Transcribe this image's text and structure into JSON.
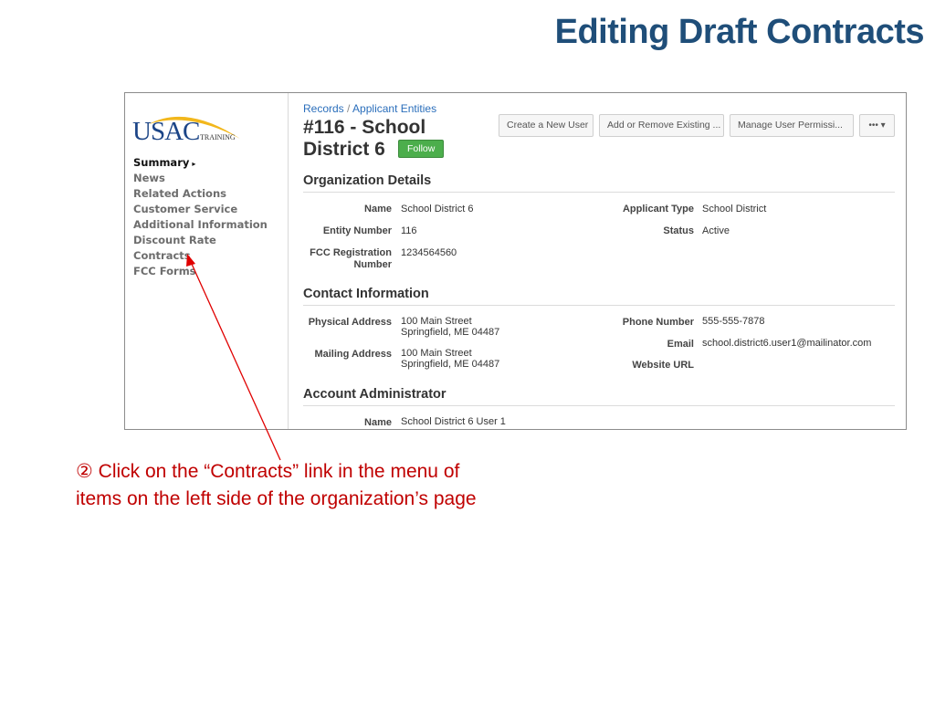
{
  "slide": {
    "title": "Editing Draft Contracts",
    "caption_line1": "② Click on the “Contracts” link in the menu of",
    "caption_line2": "items on the left side of the organization’s page",
    "annotation_color": "#c00000"
  },
  "logo": {
    "name": "USAC",
    "sub": "TRAINING"
  },
  "sidebar": {
    "items": [
      {
        "label": "Summary",
        "active": true
      },
      {
        "label": "News"
      },
      {
        "label": "Related Actions"
      },
      {
        "label": "Customer Service"
      },
      {
        "label": "Additional Information"
      },
      {
        "label": "Discount Rate"
      },
      {
        "label": "Contracts",
        "highlighted": true
      },
      {
        "label": "FCC Forms"
      }
    ]
  },
  "header": {
    "breadcrumb": [
      "Records",
      "Applicant Entities"
    ],
    "breadcrumb_sep": "/",
    "title_line1": "#116 - School",
    "title_line2": "District 6",
    "follow_label": "Follow",
    "buttons": [
      "Create a New User",
      "Add or Remove Existing ...",
      "Manage User Permissi...",
      "•••"
    ]
  },
  "org_details": {
    "heading": "Organization Details",
    "name_label": "Name",
    "name_value": "School District 6",
    "entity_label": "Entity Number",
    "entity_value": "116",
    "fcc_label": "FCC Registration Number",
    "fcc_value": "1234564560",
    "type_label": "Applicant Type",
    "type_value": "School District",
    "status_label": "Status",
    "status_value": "Active"
  },
  "contact": {
    "heading": "Contact Information",
    "physical_label": "Physical Address",
    "physical_line1": "100 Main Street",
    "physical_line2": "Springfield, ME 04487",
    "mailing_label": "Mailing Address",
    "mailing_line1": "100 Main Street",
    "mailing_line2": "Springfield, ME 04487",
    "phone_label": "Phone Number",
    "phone_value": "555-555-7878",
    "email_label": "Email",
    "email_value": "school.district6.user1@mailinator.com",
    "website_label": "Website URL"
  },
  "admin": {
    "heading": "Account Administrator",
    "name_label": "Name",
    "name_value": "School District 6 User 1"
  }
}
